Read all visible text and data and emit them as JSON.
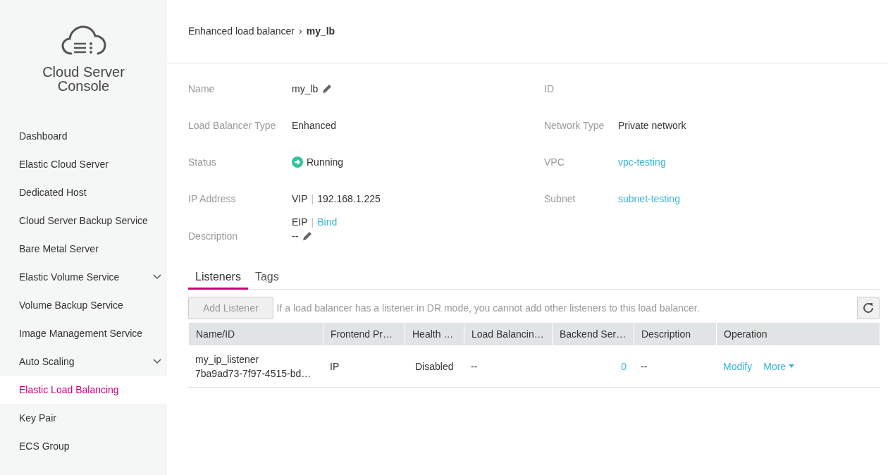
{
  "sidebar": {
    "title": "Cloud Server Console",
    "items": [
      {
        "label": "Dashboard",
        "selected": false,
        "expandable": false
      },
      {
        "label": "Elastic Cloud Server",
        "selected": false,
        "expandable": false
      },
      {
        "label": "Dedicated Host",
        "selected": false,
        "expandable": false
      },
      {
        "label": "Cloud Server Backup Service",
        "selected": false,
        "expandable": false
      },
      {
        "label": "Bare Metal Server",
        "selected": false,
        "expandable": false
      },
      {
        "label": "Elastic Volume Service",
        "selected": false,
        "expandable": true
      },
      {
        "label": "Volume Backup Service",
        "selected": false,
        "expandable": false
      },
      {
        "label": "Image Management Service",
        "selected": false,
        "expandable": false
      },
      {
        "label": "Auto Scaling",
        "selected": false,
        "expandable": true
      },
      {
        "label": "Elastic Load Balancing",
        "selected": true,
        "expandable": false
      },
      {
        "label": "Key Pair",
        "selected": false,
        "expandable": false
      },
      {
        "label": "ECS Group",
        "selected": false,
        "expandable": false
      }
    ]
  },
  "breadcrumb": {
    "parent": "Enhanced load balancer",
    "separator": "›",
    "current": "my_lb"
  },
  "details_left": [
    {
      "label": "Name",
      "kind": "editable",
      "value": "my_lb"
    },
    {
      "label": "Load Balancer Type",
      "kind": "text",
      "value": "Enhanced"
    },
    {
      "label": "Status",
      "kind": "status",
      "value": "Running"
    },
    {
      "label": "IP Address",
      "kind": "ip",
      "lines": [
        {
          "prefix": "VIP",
          "separator": "|",
          "value": "192.168.1.225",
          "link": false
        },
        {
          "prefix": "EIP",
          "separator": "|",
          "value": "Bind",
          "link": true
        }
      ]
    },
    {
      "label": "Description",
      "kind": "editable",
      "value": "--"
    }
  ],
  "details_right": [
    {
      "label": "ID",
      "kind": "empty"
    },
    {
      "label": "Network Type",
      "kind": "text",
      "value": "Private network"
    },
    {
      "label": "VPC",
      "kind": "link",
      "value": "vpc-testing"
    },
    {
      "label": "Subnet",
      "kind": "link",
      "value": "subnet-testing"
    }
  ],
  "tabs": [
    {
      "label": "Listeners",
      "selected": true
    },
    {
      "label": "Tags",
      "selected": false
    }
  ],
  "toolbar": {
    "add_button": "Add Listener",
    "add_disabled": true,
    "hint": "If a load balancer has a listener in DR mode, you cannot add other listeners to this load balancer."
  },
  "table": {
    "columns": [
      "Name/ID",
      "Frontend Pr…",
      "Health …",
      "Load Balancin…",
      "Backend Ser…",
      "Description",
      "Operation"
    ],
    "rows": [
      {
        "name": "my_ip_listener",
        "id": "7ba9ad73-7f97-4515-bd…",
        "frontend": "IP",
        "health": "Disabled",
        "balancing": "--",
        "backend": "0",
        "description": "--",
        "operations": [
          {
            "label": "Modify",
            "menu": false
          },
          {
            "label": "More",
            "menu": true
          }
        ]
      }
    ]
  }
}
